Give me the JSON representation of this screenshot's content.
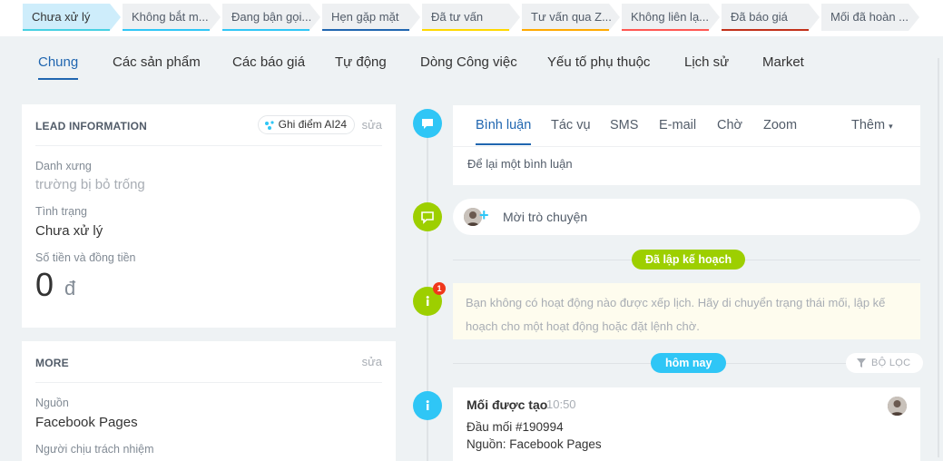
{
  "stages": [
    {
      "label": "Chưa xử lý",
      "color": "#47d1e2",
      "active": true
    },
    {
      "label": "Không bắt m...",
      "color": "#2fc6f6",
      "active": false
    },
    {
      "label": "Đang bận gọi...",
      "color": "#2fc6f6",
      "active": false
    },
    {
      "label": "Hẹn gặp mặt",
      "color": "#2066b0",
      "active": false
    },
    {
      "label": "Đã tư vấn",
      "color": "#ffd800",
      "active": false
    },
    {
      "label": "Tư vấn qua Z...",
      "color": "#ffa900",
      "active": false
    },
    {
      "label": "Không liên lạ...",
      "color": "#ff5752",
      "active": false
    },
    {
      "label": "Đã báo giá",
      "color": "#c2301a",
      "active": false
    },
    {
      "label": "Mối đã hoàn ...",
      "color": "#eef0f2",
      "active": false
    }
  ],
  "tabs": [
    "Chung",
    "Các sản phẩm",
    "Các báo giá",
    "Tự động",
    "Dòng Công việc",
    "Yếu tố phụ thuộc",
    "Lịch sử",
    "Market"
  ],
  "lead_card": {
    "title": "LEAD INFORMATION",
    "ai_label": "Ghi điểm AI24",
    "edit": "sửa",
    "fields": [
      {
        "label": "Danh xưng",
        "value": "trường bị bỏ trống"
      },
      {
        "label": "Tình trạng",
        "value": "Chưa xử lý"
      },
      {
        "label": "Số tiền và đồng tiền",
        "value": "0",
        "currency": "đ"
      }
    ]
  },
  "more_card": {
    "title": "MORE",
    "edit": "sửa",
    "fields": [
      {
        "label": "Nguồn",
        "value": "Facebook Pages"
      },
      {
        "label": "Người chịu trách nhiệm"
      }
    ]
  },
  "editor": {
    "tabs": [
      "Bình luận",
      "Tác vụ",
      "SMS",
      "E-mail",
      "Chờ",
      "Zoom"
    ],
    "more": "Thêm",
    "placeholder": "Để lại một bình luận"
  },
  "chat": {
    "label": "Mời trò chuyện"
  },
  "planned": {
    "label": "Đã lập kế hoạch",
    "badge": "1",
    "notice": "Bạn không có hoạt động nào được xếp lịch. Hãy di chuyển trạng thái mối, lập kế hoạch cho một hoạt động hoặc đặt lệnh chờ."
  },
  "today": {
    "label": "hôm nay",
    "filter": "BỘ LỌC"
  },
  "activity": {
    "title": "Mối được tạo",
    "time": "10:50",
    "line1": "Đầu mối #190994",
    "line2": "Nguồn: Facebook Pages"
  },
  "colors": {
    "accent": "#2066b0",
    "green": "#9dcf00",
    "blue": "#2fc6f6",
    "notice_bg": "#fefcee"
  }
}
